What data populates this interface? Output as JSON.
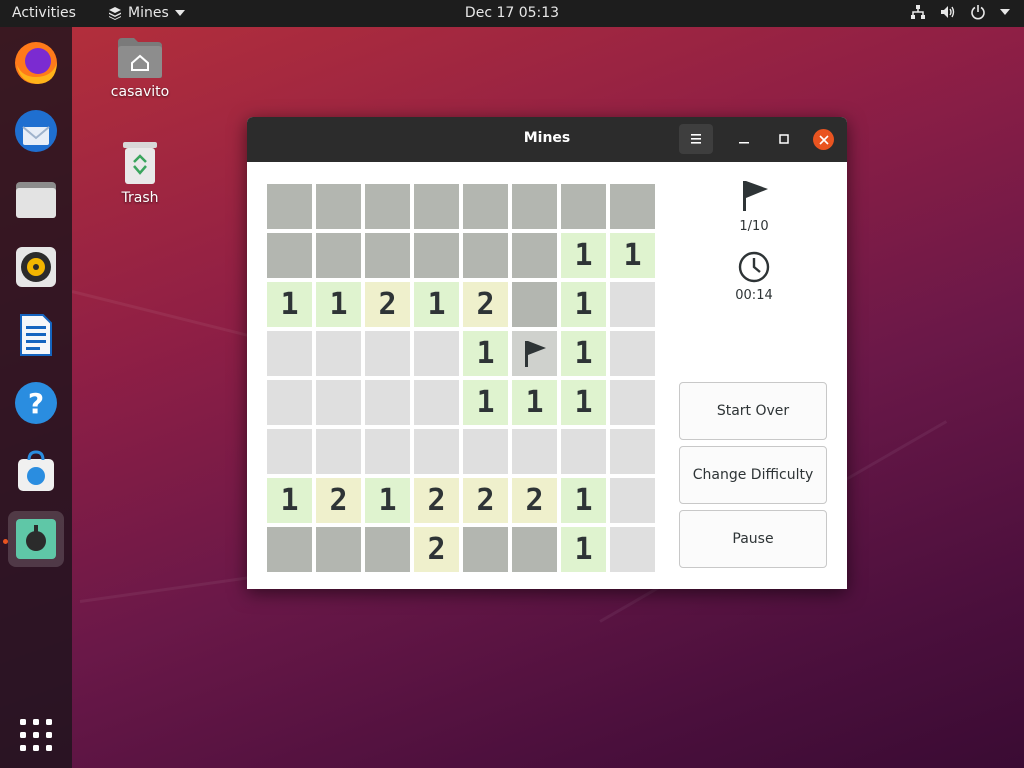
{
  "topbar": {
    "activities": "Activities",
    "app_name": "Mines",
    "datetime": "Dec 17  05:13",
    "tray_icons": [
      "network-icon",
      "volume-icon",
      "power-icon"
    ]
  },
  "dock": {
    "items": [
      "firefox-icon",
      "thunderbird-icon",
      "files-icon",
      "rhythmbox-icon",
      "libreoffice-writer-icon",
      "help-icon",
      "software-center-icon",
      "mines-icon"
    ],
    "active": "mines-icon",
    "show_apps": "show-applications-icon"
  },
  "desktop": {
    "icons": [
      {
        "label": "casavito",
        "icon": "home-folder-icon"
      },
      {
        "label": "Trash",
        "icon": "trash-icon"
      }
    ]
  },
  "window": {
    "title": "Mines",
    "flags_count": "1/10",
    "elapsed_time": "00:14",
    "buttons": {
      "start_over": "Start Over",
      "change_difficulty": "Change Difficulty",
      "pause": "Pause"
    }
  },
  "board": {
    "rows": 8,
    "cols": 8,
    "legend": "# = unrevealed, . = revealed empty, F = flag, digits = adjacent mine count",
    "grid": [
      [
        "#",
        "#",
        "#",
        "#",
        "#",
        "#",
        "#",
        "#"
      ],
      [
        "#",
        "#",
        "#",
        "#",
        "#",
        "#",
        "1",
        "1"
      ],
      [
        "1",
        "1",
        "2",
        "1",
        "2",
        "#",
        "1",
        "."
      ],
      [
        ".",
        ".",
        ".",
        ".",
        "1",
        "F",
        "1",
        "."
      ],
      [
        ".",
        ".",
        ".",
        ".",
        "1",
        "1",
        "1",
        "."
      ],
      [
        ".",
        ".",
        ".",
        ".",
        ".",
        ".",
        ".",
        "."
      ],
      [
        "1",
        "2",
        "1",
        "2",
        "2",
        "2",
        "1",
        "."
      ],
      [
        "#",
        "#",
        "#",
        "2",
        "#",
        "#",
        "1",
        "."
      ]
    ]
  },
  "colors": {
    "topbar": "#1d1d1d",
    "titlebar": "#2c2c2c",
    "close_button": "#e95420",
    "cell_closed": "#b3b6b0",
    "cell_empty": "#dfdfdf",
    "cell_one": "#dff3cf",
    "cell_two": "#eff0cc"
  }
}
